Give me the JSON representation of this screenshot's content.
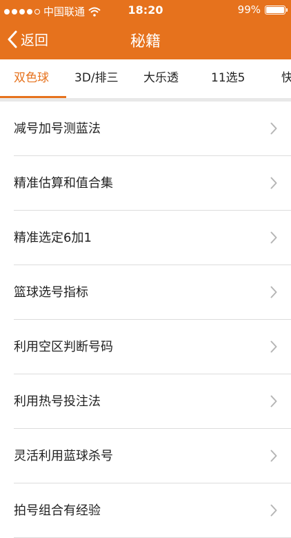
{
  "status_bar": {
    "carrier": "中国联通",
    "time": "18:20",
    "battery_percent": "99%",
    "battery_level": 0.99,
    "signal_dots_filled": 4,
    "signal_dots_total": 5
  },
  "nav": {
    "back_label": "返回",
    "title": "秘籍"
  },
  "tabs": [
    {
      "label": "双色球",
      "active": true
    },
    {
      "label": "3D/排三",
      "active": false
    },
    {
      "label": "大乐透",
      "active": false
    },
    {
      "label": "11选5",
      "active": false
    },
    {
      "label": "快",
      "active": false
    }
  ],
  "list": [
    {
      "label": "减号加号测蓝法"
    },
    {
      "label": "精准估算和值合集"
    },
    {
      "label": "精准选定6加1"
    },
    {
      "label": "篮球选号指标"
    },
    {
      "label": "利用空区判断号码"
    },
    {
      "label": "利用热号投注法"
    },
    {
      "label": "灵活利用蓝球杀号"
    },
    {
      "label": "拍号组合有经验"
    }
  ],
  "colors": {
    "accent": "#e6721d",
    "text": "#222222",
    "separator": "#dcdcdc"
  },
  "icons": {
    "back": "chevron-left-icon",
    "row": "chevron-right-icon",
    "wifi": "wifi-icon",
    "battery": "battery-icon"
  }
}
